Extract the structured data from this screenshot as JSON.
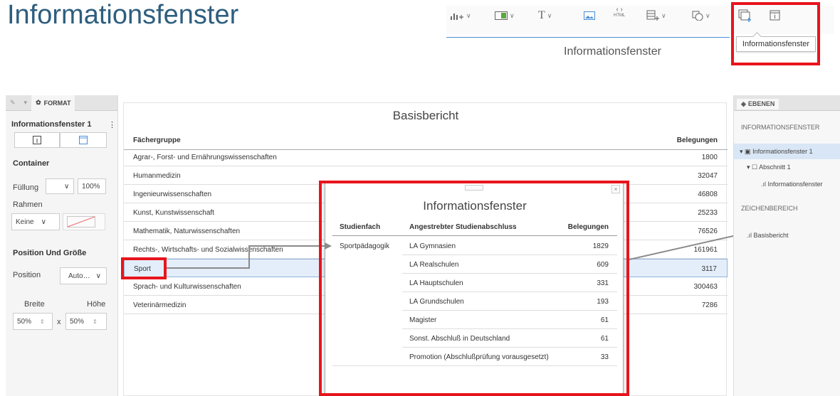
{
  "slide_title": "Informationsfenster",
  "toolbar": {
    "caption": "Informationsfenster",
    "tooltip": "Informationsfenster",
    "html_label": "HTML",
    "text_glyph": "T",
    "icons": [
      "chart-add-icon",
      "input-control-icon",
      "text-icon",
      "image-icon",
      "html-icon",
      "table-add-icon",
      "shape-icon",
      "container-add-icon",
      "info-window-icon"
    ]
  },
  "left_panel": {
    "tab_format": "FORMAT",
    "widget_name": "Informationsfenster 1",
    "container_heading": "Container",
    "fill_label": "Füllung",
    "fill_percent": "100%",
    "border_label": "Rahmen",
    "border_value": "Keine",
    "position_heading": "Position Und Größe",
    "position_label": "Position",
    "position_value": "Auto…",
    "width_label": "Breite",
    "height_label": "Höhe",
    "width_value": "50%",
    "height_value": "50%",
    "times": "x"
  },
  "report": {
    "title": "Basisbericht",
    "col_group": "Fächergruppe",
    "col_count": "Belegungen",
    "rows": [
      {
        "name": "Agrar-, Forst- und Ernährungswissenschaften",
        "value": "1800"
      },
      {
        "name": "Humanmedizin",
        "value": "32047"
      },
      {
        "name": "Ingenieurwissenschaften",
        "value": "46808"
      },
      {
        "name": "Kunst, Kunstwissenschaft",
        "value": "25233"
      },
      {
        "name": "Mathematik, Naturwissenschaften",
        "value": "76526"
      },
      {
        "name": "Rechts-, Wirtschafts- und Sozialwissenschaften",
        "value": "161961"
      },
      {
        "name": "Sport",
        "value": "3117"
      },
      {
        "name": "Sprach- und Kulturwissenschaften",
        "value": "300463"
      },
      {
        "name": "Veterinärmedizin",
        "value": "7286"
      }
    ]
  },
  "popup": {
    "title": "Informationsfenster",
    "col1": "Studienfach",
    "col2": "Angestrebter Studienabschluss",
    "col3": "Belegungen",
    "subject": "Sportpädagogik",
    "close": "×",
    "rows": [
      {
        "degree": "LA Gymnasien",
        "value": "1829"
      },
      {
        "degree": "LA Realschulen",
        "value": "609"
      },
      {
        "degree": "LA Hauptschulen",
        "value": "331"
      },
      {
        "degree": "LA Grundschulen",
        "value": "193"
      },
      {
        "degree": "Magister",
        "value": "61"
      },
      {
        "degree": "Sonst. Abschluß in Deutschland",
        "value": "61"
      },
      {
        "degree": "Promotion (Abschlußprüfung vorausgesetzt)",
        "value": "33"
      }
    ]
  },
  "right_panel": {
    "tab_layers": "EBENEN",
    "section_info": "INFORMATIONSFENSTER",
    "tree_info": "Informationsfenster 1",
    "tree_section": "Abschnitt 1",
    "tree_chart": "Informationsfenster",
    "section_canvas": "ZEICHENBEREICH",
    "tree_report": "Basisbericht"
  },
  "colors": {
    "title": "#2e5e7e",
    "highlight": "#e8141c",
    "selection": "#e4eefa",
    "toolbar_underline": "#4a8fd8"
  }
}
